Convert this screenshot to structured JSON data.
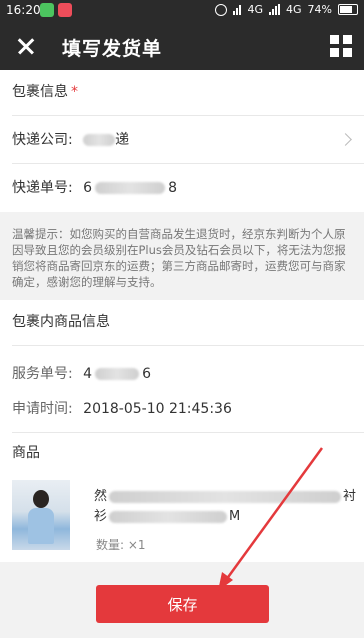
{
  "status_bar": {
    "time": "16:20",
    "network": "4G",
    "network2": "4G",
    "battery": "74%"
  },
  "header": {
    "title": "填写发货单"
  },
  "package_info": {
    "heading": "包裹信息",
    "required_mark": "*",
    "courier_label": "快递公司:",
    "courier_value_visible": "递",
    "tracking_label": "快递单号:",
    "tracking_value_prefix": "6",
    "tracking_value_suffix": "8"
  },
  "notice": {
    "text": "温馨提示：如您购买的自营商品发生退货时，经京东判断为个人原因导致且您的会员级别在Plus会员及钻石会员以下，将无法为您报销您将商品寄回京东的运费；第三方商品邮寄时，运费您可与商家确定，感谢您的理解与支持。"
  },
  "package_contents": {
    "heading": "包裹内商品信息",
    "service_label": "服务单号:",
    "service_value_prefix": "4",
    "service_value_suffix": "6",
    "apply_time_label": "申请时间:",
    "apply_time_value": "2018-05-10 21:45:36",
    "goods_heading": "商品",
    "product_name_start": "然",
    "product_name_end": "衬",
    "product_line2_start": "衫",
    "product_line2_end": "M",
    "quantity_label": "数量: ×1"
  },
  "actions": {
    "save_label": "保存"
  },
  "colors": {
    "accent": "#e4393c",
    "header_bg": "#2b2b2b"
  }
}
